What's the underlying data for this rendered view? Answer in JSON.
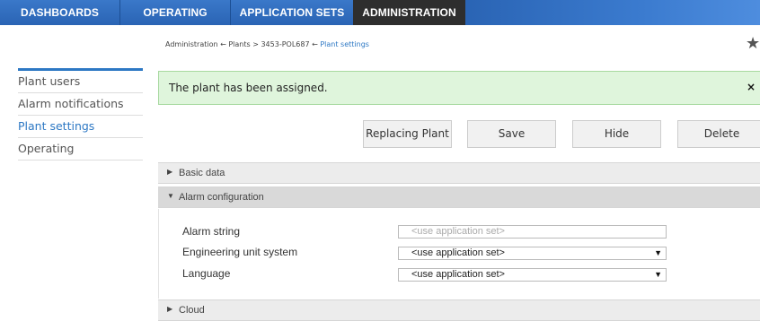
{
  "nav": {
    "tabs": [
      "DASHBOARDS",
      "OPERATING",
      "APPLICATION SETS",
      "ADMINISTRATION"
    ],
    "active_tab": "ADMINISTRATION"
  },
  "breadcrumb": {
    "parts": [
      "Administration",
      "Plants",
      "3453-POL687",
      "Plant settings"
    ],
    "separators": [
      "←",
      ">",
      "←"
    ]
  },
  "favorite_icon": "star-icon",
  "sidebar": {
    "items": [
      {
        "label": "Plant users"
      },
      {
        "label": "Alarm notifications"
      },
      {
        "label": "Plant settings",
        "active": true
      },
      {
        "label": "Operating"
      }
    ]
  },
  "alert": {
    "message": "The plant has been assigned.",
    "close": "×"
  },
  "buttons": {
    "replacing": "Replacing Plant",
    "save": "Save",
    "hide": "Hide",
    "delete": "Delete"
  },
  "sections": {
    "basic": "Basic data",
    "alarm": "Alarm configuration",
    "cloud": "Cloud"
  },
  "alarm_config": {
    "alarm_string_label": "Alarm string",
    "alarm_string_placeholder": "<use application set>",
    "unit_label": "Engineering unit system",
    "unit_value": "<use application set>",
    "language_label": "Language",
    "language_value": "<use application set>"
  },
  "colors": {
    "nav": "#2a64b4",
    "nav_active": "#2e2e2e",
    "accent": "#2d78c4",
    "alert_bg": "#dff5dc"
  }
}
